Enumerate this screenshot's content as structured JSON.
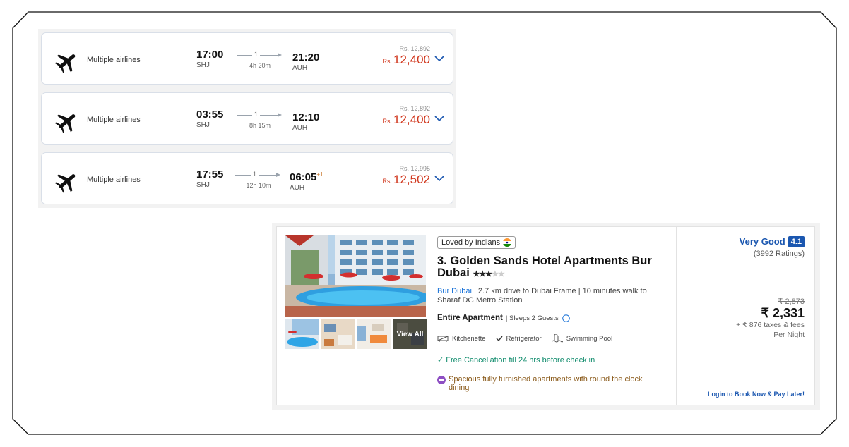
{
  "flights": [
    {
      "airline": "Multiple airlines",
      "dep_time": "17:00",
      "dep_code": "SHJ",
      "stops": "1",
      "duration": "4h 20m",
      "arr_time": "21:20",
      "arr_code": "AUH",
      "arr_day_offset": "",
      "old_price": "Rs. 12,892",
      "currency": "Rs.",
      "price": "12,400"
    },
    {
      "airline": "Multiple airlines",
      "dep_time": "03:55",
      "dep_code": "SHJ",
      "stops": "1",
      "duration": "8h 15m",
      "arr_time": "12:10",
      "arr_code": "AUH",
      "arr_day_offset": "",
      "old_price": "Rs. 12,892",
      "currency": "Rs.",
      "price": "12,400"
    },
    {
      "airline": "Multiple airlines",
      "dep_time": "17:55",
      "dep_code": "SHJ",
      "stops": "1",
      "duration": "12h 10m",
      "arr_time": "06:05",
      "arr_code": "AUH",
      "arr_day_offset": "+1",
      "old_price": "Rs. 12,995",
      "currency": "Rs.",
      "price": "12,502"
    }
  ],
  "hotel": {
    "badge": "Loved by Indians",
    "name": "3. Golden Sands Hotel Apartments Bur Dubai",
    "stars_filled": 3,
    "stars_total": 5,
    "area": "Bur Dubai",
    "location_detail": " | 2.7 km drive to Dubai Frame | 10 minutes walk to Sharaf DG Metro Station",
    "property_type": "Entire Apartment",
    "sleeps": "| Sleeps 2 Guests",
    "amenities": [
      "Kitchenette",
      "Refrigerator",
      "Swimming Pool"
    ],
    "cancellation": "Free Cancellation till 24 hrs before check in",
    "promo": "Spacious fully furnished apartments with round the clock dining",
    "view_all": "View All",
    "rating_label": "Very Good",
    "rating_score": "4.1",
    "rating_count": "(3992 Ratings)",
    "old_price": "₹ 2,873",
    "price": "₹ 2,331",
    "taxes": "+ ₹ 876 taxes & fees",
    "per_night": "Per Night",
    "book_later": "Login to Book Now & Pay Later!"
  },
  "colors": {
    "accent_blue": "#1b57b0",
    "price_red": "#d0351b",
    "cancel_green": "#0c8a6a"
  }
}
